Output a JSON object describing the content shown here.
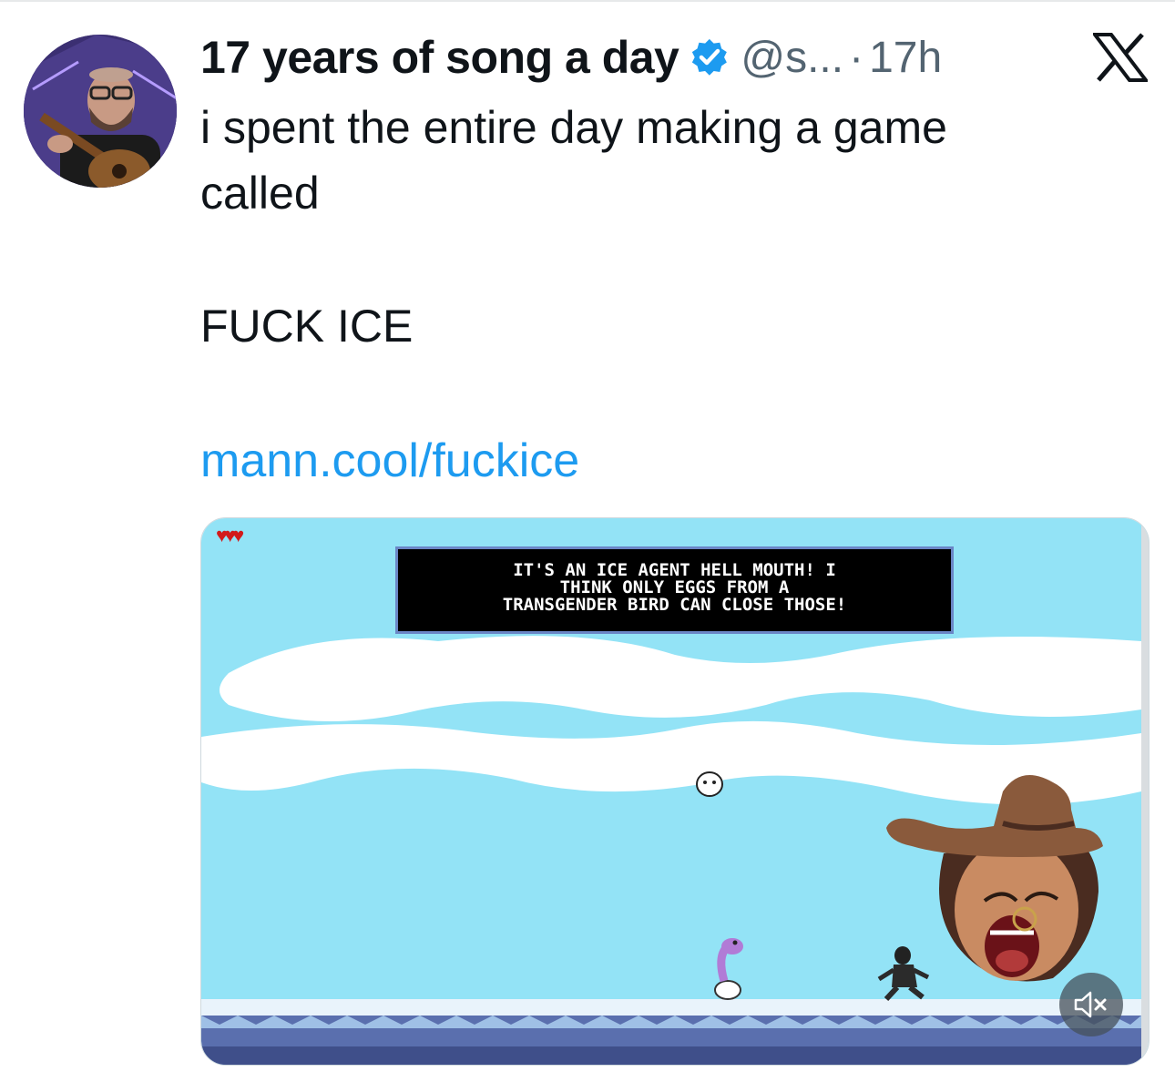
{
  "author": {
    "display_name": "17 years of song a day",
    "handle": "@s...",
    "separator": "·",
    "time": "17h",
    "verified": true
  },
  "tweet": {
    "lines": [
      "i spent the entire day making a game",
      "called"
    ],
    "caps": "FUCK ICE",
    "link": "mann.cool/fuckice"
  },
  "media": {
    "hearts": "♥♥♥",
    "dialog": [
      "IT'S AN ICE AGENT HELL MOUTH! I",
      "THINK ONLY EGGS FROM A",
      "TRANSGENDER BIRD CAN CLOSE THOSE!"
    ]
  },
  "icons": {
    "verified": "verified-badge-icon",
    "platform": "x-logo-icon",
    "mute": "speaker-muted-icon"
  },
  "colors": {
    "link": "#1d9bf0",
    "verified": "#1d9bf0",
    "sky": "#93e3f6",
    "secondary_text": "#536471"
  }
}
